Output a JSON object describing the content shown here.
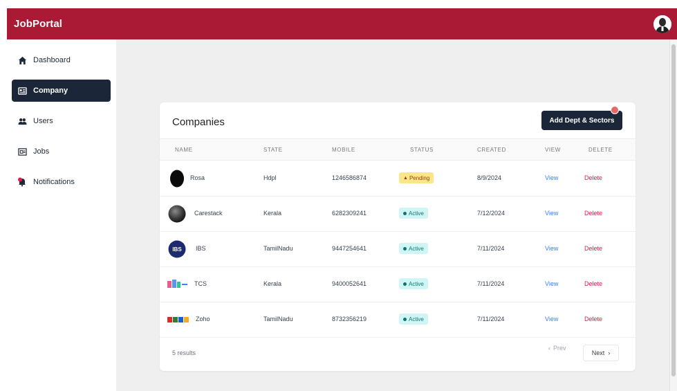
{
  "navbar": {
    "brand": "JobPortal"
  },
  "sidebar": {
    "items": [
      {
        "label": "Dashboard",
        "icon": "home-icon"
      },
      {
        "label": "Company",
        "icon": "id-card-icon",
        "active": true
      },
      {
        "label": "Users",
        "icon": "users-icon"
      },
      {
        "label": "Jobs",
        "icon": "briefcase-icon"
      },
      {
        "label": "Notifications",
        "icon": "bell-icon"
      }
    ]
  },
  "main": {
    "card_title": "Companies",
    "add_button": "Add Dept & Sectors",
    "columns": [
      "NAME",
      "STATE",
      "MOBILE",
      "STATUS",
      "CREATED",
      "VIEW",
      "DELETE"
    ],
    "rows": [
      {
        "name": "Rosa",
        "state": "Hdpl",
        "mobile": "1246586874",
        "status": "Pending",
        "created": "8/9/2024",
        "view": "View",
        "delete": "Delete"
      },
      {
        "name": "Carestack",
        "state": "Kerala",
        "mobile": "6282309241",
        "status": "Active",
        "created": "7/12/2024",
        "view": "View",
        "delete": "Delete"
      },
      {
        "name": "IBS",
        "state": "TamilNadu",
        "mobile": "9447254641",
        "status": "Active",
        "created": "7/11/2024",
        "view": "View",
        "delete": "Delete"
      },
      {
        "name": "TCS",
        "state": "Kerala",
        "mobile": "9400052641",
        "status": "Active",
        "created": "7/11/2024",
        "view": "View",
        "delete": "Delete"
      },
      {
        "name": "Zoho",
        "state": "TamilNadu",
        "mobile": "8732356219",
        "status": "Active",
        "created": "7/11/2024",
        "view": "View",
        "delete": "Delete"
      }
    ],
    "results_text": "5 results",
    "prev_label": "Prev",
    "next_label": "Next"
  },
  "colors": {
    "navbar": "#aa1a35",
    "active_nav": "#1b2639",
    "pending": "#fde68a",
    "active": "#cff6f4"
  }
}
